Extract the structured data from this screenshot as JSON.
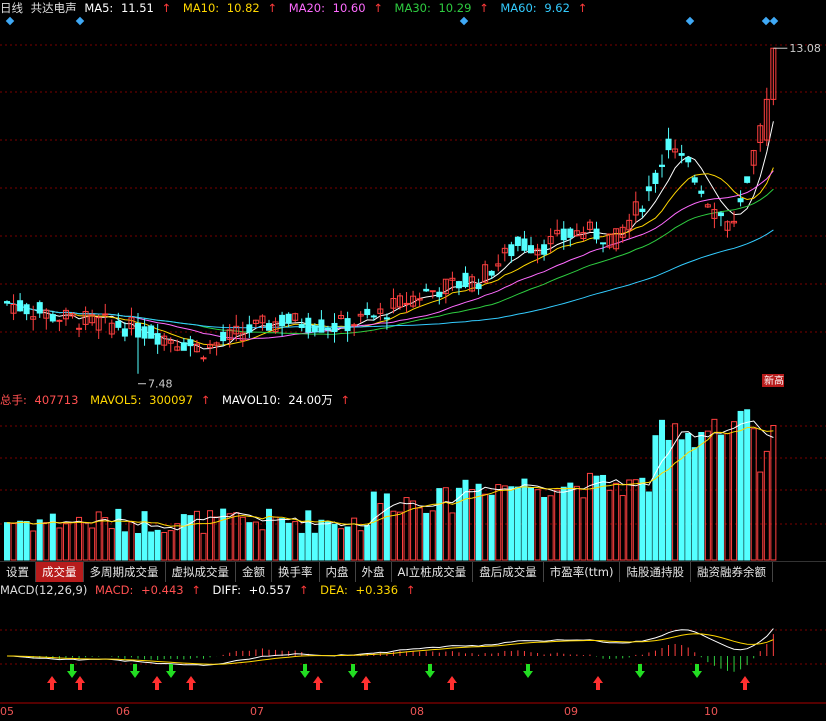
{
  "header": {
    "period": "日线",
    "stock_name": "共达电声",
    "ma": [
      {
        "label": "MA5:",
        "value": "11.51",
        "color": "#ffffff"
      },
      {
        "label": "MA10:",
        "value": "10.82",
        "color": "#ffd700"
      },
      {
        "label": "MA20:",
        "value": "10.60",
        "color": "#ff6bff"
      },
      {
        "label": "MA30:",
        "value": "10.29",
        "color": "#2ecc40"
      },
      {
        "label": "MA60:",
        "value": "9.62",
        "color": "#33ccff"
      }
    ],
    "arrow": "↑"
  },
  "volume_header": {
    "total_label": "总手:",
    "total_value": "407713",
    "mavol5_label": "MAVOL5:",
    "mavol5_value": "300097",
    "mavol10_label": "MAVOL10:",
    "mavol10_value": "24.00万"
  },
  "macd_header": {
    "name": "MACD(12,26,9)",
    "macd_label": "MACD:",
    "macd_value": "+0.443",
    "diff_label": "DIFF:",
    "diff_value": "+0.557",
    "dea_label": "DEA:",
    "dea_value": "+0.336"
  },
  "tabs": [
    "设置",
    "成交量",
    "多周期成交量",
    "虚拟成交量",
    "金额",
    "换手率",
    "内盘",
    "外盘",
    "AI立桩成交量",
    "盘后成交量",
    "市盈率(ttm)",
    "陆股通持股",
    "融资融券余额"
  ],
  "active_tab": 1,
  "annotations": {
    "high": "13.08",
    "low": "7.48",
    "badge": "新高"
  },
  "months": [
    "05",
    "06",
    "07",
    "08",
    "09",
    "10"
  ],
  "colors": {
    "up": "#ff4040",
    "down": "#54ffff",
    "grid": "#7a0000",
    "background": "#000000"
  },
  "chart_data": {
    "type": "candlestick",
    "y_price_range": [
      7.2,
      13.6
    ],
    "n_days": 118,
    "last_close": 13.08,
    "last_high": 13.08,
    "period_low": 7.48,
    "mavol5": 300097,
    "mavol10": 240000,
    "last_volume": 407713,
    "macd": {
      "macd": 0.443,
      "diff": 0.557,
      "dea": 0.336
    }
  }
}
